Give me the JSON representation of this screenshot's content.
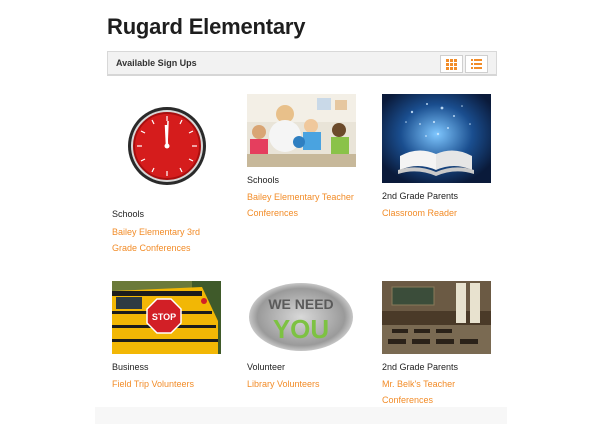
{
  "page": {
    "title": "Rugard Elementary"
  },
  "signups": {
    "heading": "Available Sign Ups"
  },
  "cards": [
    {
      "category": "Schools",
      "title": "Bailey Elementary 3rd Grade Conferences",
      "image": "red-clock"
    },
    {
      "category": "Schools",
      "title": "Bailey Elementary Teacher Conferences",
      "image": "teacher-with-children"
    },
    {
      "category": "2nd Grade Parents",
      "title": "Classroom Reader",
      "image": "open-book"
    },
    {
      "category": "Business",
      "title": "Field Trip Volunteers",
      "image": "school-bus-stop-sign"
    },
    {
      "category": "Volunteer",
      "title": "Library Volunteers",
      "image": "we-need-you-sign"
    },
    {
      "category": "2nd Grade Parents",
      "title": "Mr. Belk's Teacher Conferences",
      "image": "classroom"
    }
  ],
  "colors": {
    "link": "#f28c28",
    "accent": "#f28c28",
    "heading": "#1e1e1e"
  },
  "icons": {
    "grid_view": "grid-icon",
    "list_view": "list-icon"
  },
  "image_text": {
    "we_need": "WE NEED",
    "you": "YOU",
    "stop": "STOP"
  }
}
